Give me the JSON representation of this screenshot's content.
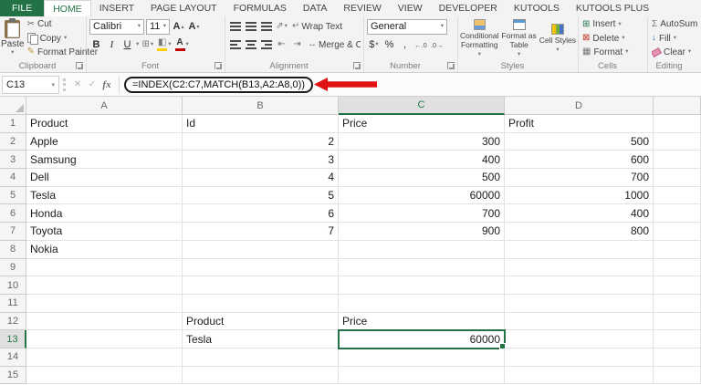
{
  "colors": {
    "excel_green": "#217346",
    "arrow_red": "#e01212"
  },
  "tab_bar": {
    "active_tab": "HOME",
    "tabs": [
      {
        "label": "FILE"
      },
      {
        "label": "HOME"
      },
      {
        "label": "INSERT"
      },
      {
        "label": "PAGE LAYOUT"
      },
      {
        "label": "FORMULAS"
      },
      {
        "label": "DATA"
      },
      {
        "label": "REVIEW"
      },
      {
        "label": "VIEW"
      },
      {
        "label": "DEVELOPER"
      },
      {
        "label": "KUTOOLS"
      },
      {
        "label": "KUTOOLS PLUS"
      }
    ]
  },
  "ribbon": {
    "clipboard": {
      "group_label": "Clipboard",
      "paste_label": "Paste",
      "cut_label": "Cut",
      "copy_label": "Copy",
      "format_painter_label": "Format Painter"
    },
    "font": {
      "group_label": "Font",
      "font_name_value": "Calibri",
      "font_size_value": "11",
      "bold_label": "B",
      "italic_label": "I",
      "underline_label": "U"
    },
    "alignment": {
      "group_label": "Alignment",
      "wrap_text_label": "Wrap Text",
      "merge_center_label": "Merge & Center"
    },
    "number": {
      "group_label": "Number",
      "number_format_value": "General",
      "currency_label": "$",
      "percent_label": "%",
      "comma_label": ","
    },
    "styles": {
      "group_label": "Styles",
      "conditional_formatting_label": "Conditional Formatting",
      "format_as_table_label": "Format as Table",
      "cell_styles_label": "Cell Styles"
    },
    "cells": {
      "group_label": "Cells",
      "insert_label": "Insert",
      "delete_label": "Delete",
      "format_label": "Format"
    },
    "editing": {
      "group_label": "Editing",
      "autosum_label": "AutoSum",
      "fill_label": "Fill",
      "clear_label": "Clear"
    }
  },
  "formula_bar": {
    "name_box_value": "C13",
    "fx_label": "fx",
    "formula": "=INDEX(C2:C7,MATCH(B13,A2:A8,0))"
  },
  "icons": {
    "dropdown": "▾",
    "caret_up": "▴",
    "cut": "✂",
    "format_painter": "✎",
    "grow_font": "A",
    "shrink_font": "A",
    "borders": "⊞",
    "fill_color": "◧",
    "font_color": "A",
    "orientation": "⇗",
    "wrap_text": "↵",
    "merge_center": "↔",
    "indent_decrease": "⇤",
    "indent_increase": "⇥",
    "increase_decimal": "←.0",
    "decrease_decimal": ".0→",
    "autosum": "Σ",
    "fill_down": "↓",
    "insert": "⊞",
    "delete": "⊠",
    "format_cells": "▦",
    "cancel": "✕",
    "enter": "✓"
  },
  "sheet": {
    "visible_columns": [
      "A",
      "B",
      "C",
      "D"
    ],
    "active_cell": "C13",
    "selected_column": "C",
    "selected_row": 13,
    "rows": [
      {
        "r": 1,
        "cells": {
          "A": "Product",
          "B": "Id",
          "C": "Price",
          "D": "Profit"
        }
      },
      {
        "r": 2,
        "cells": {
          "A": "Apple",
          "B": "2",
          "C": "300",
          "D": "500"
        }
      },
      {
        "r": 3,
        "cells": {
          "A": "Samsung",
          "B": "3",
          "C": "400",
          "D": "600"
        }
      },
      {
        "r": 4,
        "cells": {
          "A": "Dell",
          "B": "4",
          "C": "500",
          "D": "700"
        }
      },
      {
        "r": 5,
        "cells": {
          "A": "Tesla",
          "B": "5",
          "C": "60000",
          "D": "1000"
        }
      },
      {
        "r": 6,
        "cells": {
          "A": "Honda",
          "B": "6",
          "C": "700",
          "D": "400"
        }
      },
      {
        "r": 7,
        "cells": {
          "A": "Toyota",
          "B": "7",
          "C": "900",
          "D": "800"
        }
      },
      {
        "r": 8,
        "cells": {
          "A": "Nokia"
        }
      },
      {
        "r": 9,
        "cells": {}
      },
      {
        "r": 10,
        "cells": {}
      },
      {
        "r": 11,
        "cells": {}
      },
      {
        "r": 12,
        "cells": {
          "B": "Product",
          "C": "Price"
        }
      },
      {
        "r": 13,
        "cells": {
          "B": "Tesla",
          "C": "60000"
        }
      },
      {
        "r": 14,
        "cells": {}
      },
      {
        "r": 15,
        "cells": {}
      }
    ]
  }
}
